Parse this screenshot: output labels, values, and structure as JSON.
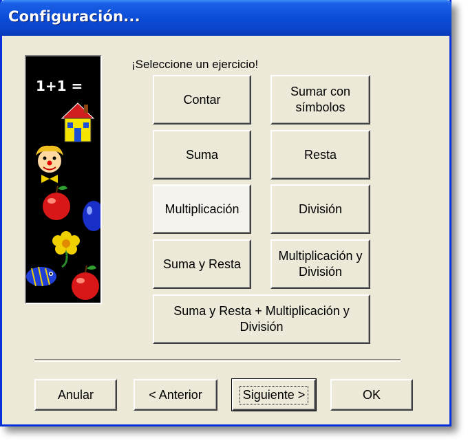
{
  "window": {
    "title": "Configuración..."
  },
  "prompt": "¡Seleccione un ejercicio!",
  "exercises": [
    {
      "label": "Contar"
    },
    {
      "label": "Sumar con\nsímbolos"
    },
    {
      "label": "Suma"
    },
    {
      "label": "Resta"
    },
    {
      "label": "Multiplicación"
    },
    {
      "label": "División"
    },
    {
      "label": "Suma y Resta"
    },
    {
      "label": "Multiplicación y\nDivisión"
    },
    {
      "label": "Suma y Resta + Multiplicación y\nDivisión"
    }
  ],
  "side_image": {
    "equation": "1+1 =",
    "icons": [
      "house-icon",
      "clown-icon",
      "apple-icon",
      "balloon-icon",
      "flower-icon",
      "fish-icon",
      "apple-icon"
    ]
  },
  "footer": {
    "cancel": "Anular",
    "back": "< Anterior",
    "next": "Siguiente >",
    "ok": "OK"
  },
  "colors": {
    "titlebar": "#0a4bd6",
    "dialog_bg": "#ece9d8",
    "image_bg": "#000000"
  }
}
